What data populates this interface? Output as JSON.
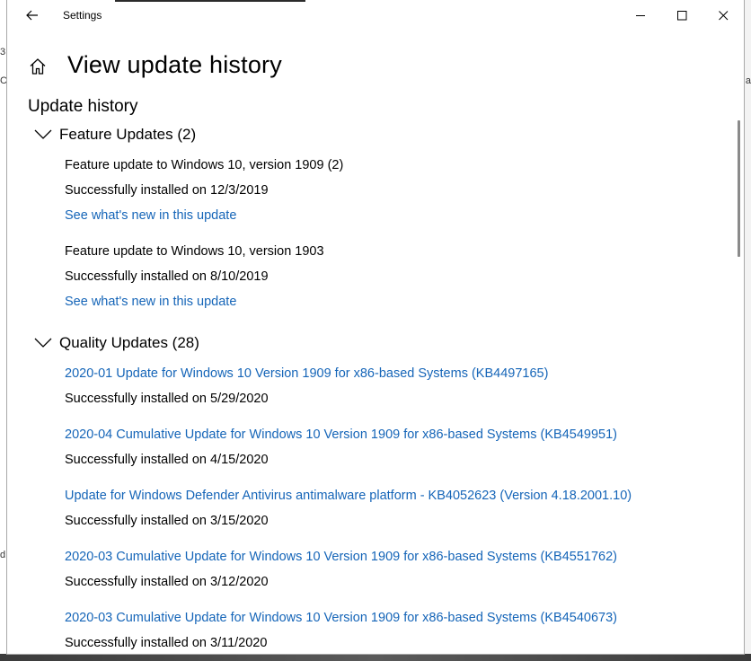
{
  "window": {
    "app_title": "Settings",
    "page_title": "View update history"
  },
  "background": {
    "left_fragments": [
      "3",
      "C",
      "d"
    ],
    "right_fragments": [
      "a"
    ]
  },
  "update_history": {
    "section_title": "Update history",
    "feature_group": {
      "label": "Feature Updates (2)",
      "items": [
        {
          "title": "Feature update to Windows 10, version 1909 (2)",
          "status": "Successfully installed on 12/3/2019",
          "link": "See what's new in this update"
        },
        {
          "title": "Feature update to Windows 10, version 1903",
          "status": "Successfully installed on 8/10/2019",
          "link": "See what's new in this update"
        }
      ]
    },
    "quality_group": {
      "label": "Quality Updates (28)",
      "items": [
        {
          "title": "2020-01 Update for Windows 10 Version 1909 for x86-based Systems (KB4497165)",
          "status": "Successfully installed on 5/29/2020"
        },
        {
          "title": "2020-04 Cumulative Update for Windows 10 Version 1909 for x86-based Systems (KB4549951)",
          "status": "Successfully installed on 4/15/2020"
        },
        {
          "title": "Update for Windows Defender Antivirus antimalware platform - KB4052623 (Version 4.18.2001.10)",
          "status": "Successfully installed on 3/15/2020"
        },
        {
          "title": "2020-03 Cumulative Update for Windows 10 Version 1909 for x86-based Systems (KB4551762)",
          "status": "Successfully installed on 3/12/2020"
        },
        {
          "title": "2020-03 Cumulative Update for Windows 10 Version 1909 for x86-based Systems (KB4540673)",
          "status": "Successfully installed on 3/11/2020"
        }
      ]
    }
  },
  "colors": {
    "link": "#1565b8",
    "text": "#000000",
    "background": "#ffffff"
  }
}
